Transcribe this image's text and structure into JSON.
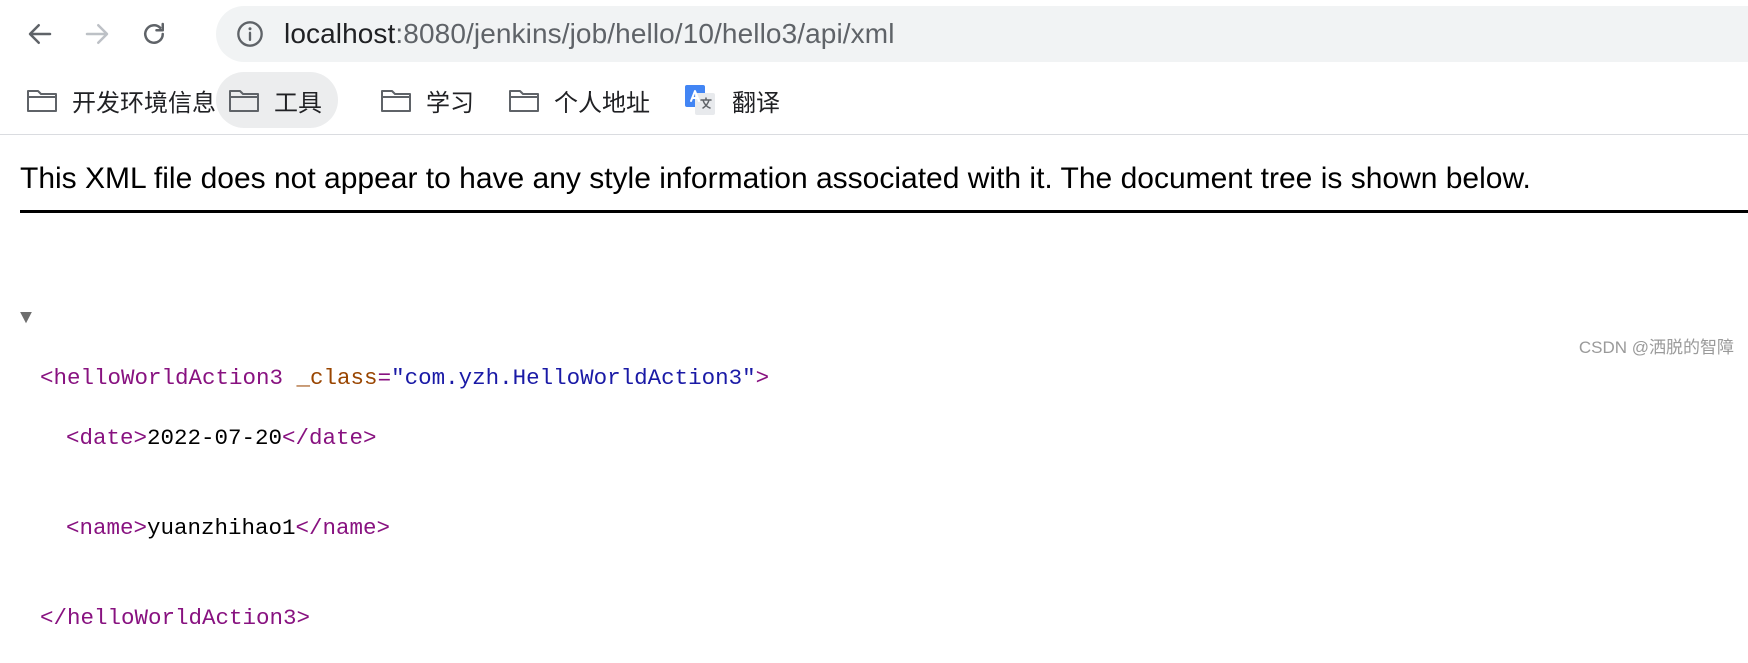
{
  "browser": {
    "url_host": "localhost",
    "url_rest": ":8080/jenkins/job/hello/10/hello3/api/xml"
  },
  "bookmarks": [
    {
      "label": "开发环境信息",
      "icon": "folder-icon"
    },
    {
      "label": "工具",
      "icon": "folder-icon"
    },
    {
      "label": "学习",
      "icon": "folder-icon"
    },
    {
      "label": "个人地址",
      "icon": "folder-icon"
    },
    {
      "label": "翻译",
      "icon": "google-translate-icon"
    }
  ],
  "page": {
    "xml_notice": "This XML file does not appear to have any style information associated with it. The document tree is shown below.",
    "tree": {
      "toggle": "▼",
      "root_open": "<helloWorldAction3",
      "attr_name": " _class",
      "attr_eq": "=",
      "attr_value": "\"com.yzh.HelloWorldAction3\"",
      "root_open_end": ">",
      "date_open": "<date>",
      "date_value": "2022-07-20",
      "date_close": "</date>",
      "name_open": "<name>",
      "name_value": "yuanzhihao1",
      "name_close": "</name>",
      "root_close": "</helloWorldAction3>"
    }
  },
  "watermark": "CSDN @洒脱的智障",
  "colors": {
    "tag": "#881280",
    "attr_name": "#994500",
    "attr_value": "#1a1aa6",
    "omnibox_bg": "#f1f3f4",
    "active_bookmark_bg": "#ecedee"
  }
}
